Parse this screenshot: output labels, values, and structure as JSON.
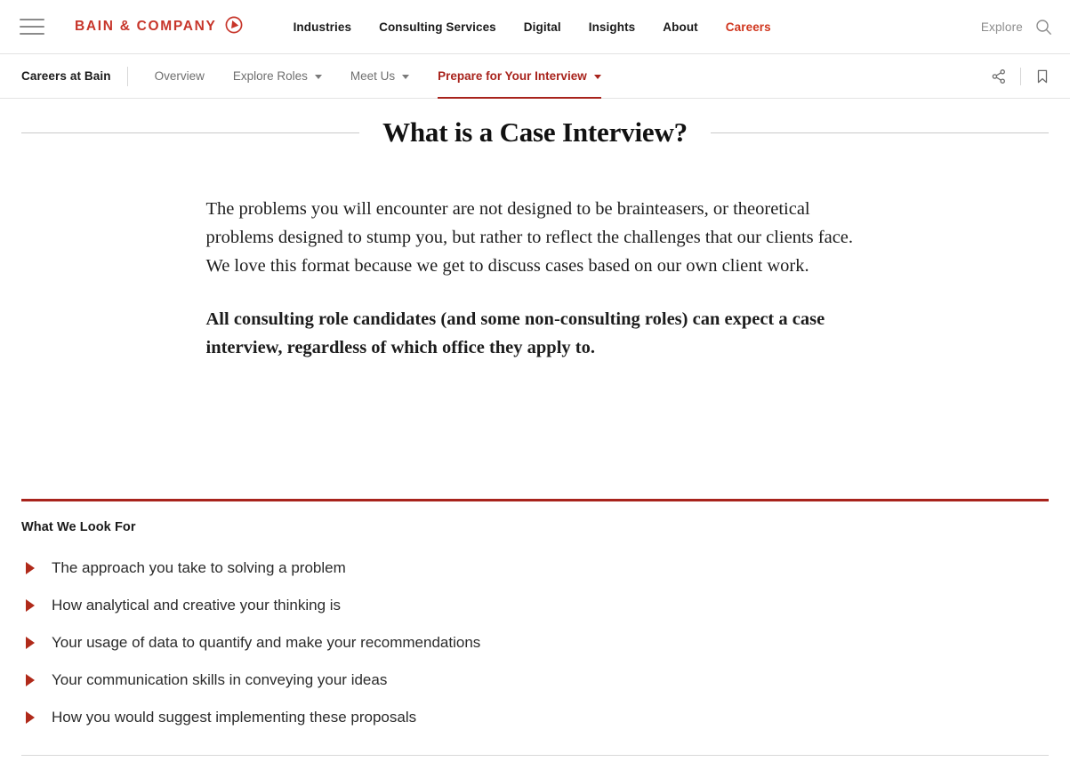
{
  "header": {
    "menu_icon": "hamburger-menu-icon",
    "brand_name": "BAIN & COMPANY",
    "brand_mark_icon": "bain-circle-arrow-logo-icon",
    "nav": [
      {
        "label": "Industries",
        "accent": false
      },
      {
        "label": "Consulting Services",
        "accent": false
      },
      {
        "label": "Digital",
        "accent": false
      },
      {
        "label": "Insights",
        "accent": false
      },
      {
        "label": "About",
        "accent": false
      },
      {
        "label": "Careers",
        "accent": true
      }
    ],
    "explore_label": "Explore",
    "search_icon": "search-icon",
    "accent_color": "#d0371f",
    "brand_color": "#c7352a"
  },
  "subnav": {
    "section_title": "Careers at Bain",
    "items": [
      {
        "label": "Overview",
        "caret": false,
        "active": false
      },
      {
        "label": "Explore Roles",
        "caret": true,
        "active": false
      },
      {
        "label": "Meet Us",
        "caret": true,
        "active": false
      },
      {
        "label": "Prepare for Your Interview",
        "caret": true,
        "active": true
      }
    ],
    "share_icon": "share-icon",
    "bookmark_icon": "bookmark-icon",
    "active_color": "#a8231c"
  },
  "article": {
    "headline": "What is a Case Interview?",
    "paragraphs": [
      {
        "text": "The problems you will encounter are not designed to be brainteasers, or theoretical problems designed to stump you, but rather to reflect the challenges that our clients face. We love this format because we get to discuss cases based on our own client work.",
        "bold": false
      },
      {
        "text": "All consulting role candidates (and some non-consulting roles) can expect a case interview, regardless of which office they apply to.",
        "bold": true
      }
    ]
  },
  "look_for": {
    "title": "What We Look For",
    "rule_color": "#a8231c",
    "bullet_icon": "triangle-right-bullet-icon",
    "items": [
      "The approach you take to solving a problem",
      "How analytical and creative your thinking is",
      "Your usage of data to quantify and make your recommendations",
      "Your communication skills in conveying your ideas",
      "How you would suggest implementing these proposals"
    ]
  }
}
